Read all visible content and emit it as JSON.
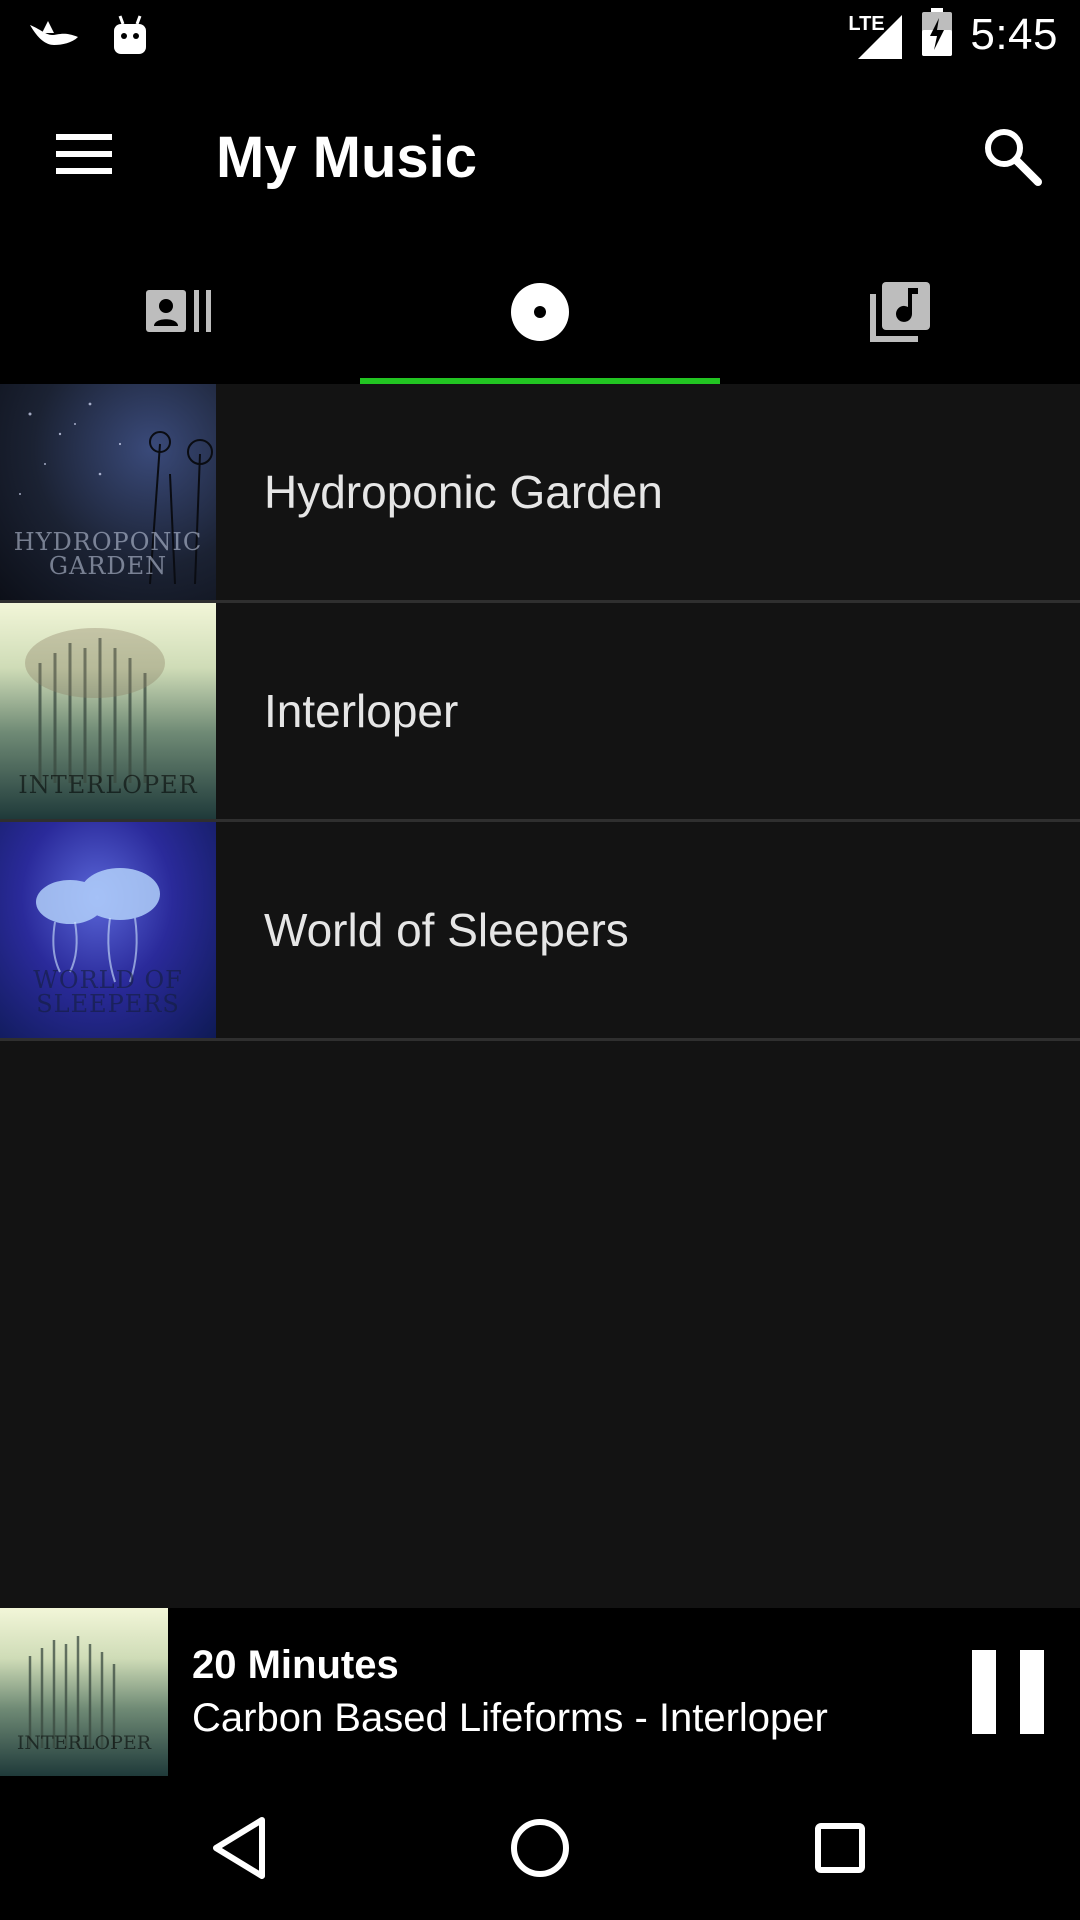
{
  "status_bar": {
    "time": "5:45",
    "icons": [
      "bird-notification-icon",
      "android-notification-icon",
      "lte-signal-icon",
      "battery-charging-icon"
    ],
    "network_label": "LTE"
  },
  "app_bar": {
    "title": "My Music",
    "menu_icon": "menu-icon",
    "search_icon": "search-icon"
  },
  "tabs": [
    {
      "icon": "artists-icon",
      "active": false
    },
    {
      "icon": "album-icon",
      "active": true
    },
    {
      "icon": "playlist-icon",
      "active": false
    }
  ],
  "accent_color": "#22c522",
  "albums": [
    {
      "title": "Hydroponic Garden",
      "art_text": "HYDROPONIC GARDEN"
    },
    {
      "title": "Interloper",
      "art_text": "INTERLOPER"
    },
    {
      "title": "World of Sleepers",
      "art_text": "WORLD OF SLEEPERS"
    }
  ],
  "now_playing": {
    "title": "20 Minutes",
    "subtitle": "Carbon Based Lifeforms - Interloper",
    "art_text": "INTERLOPER",
    "control_icon": "pause-icon"
  },
  "nav_bar": {
    "icons": [
      "back-icon",
      "home-icon",
      "recents-icon"
    ]
  }
}
